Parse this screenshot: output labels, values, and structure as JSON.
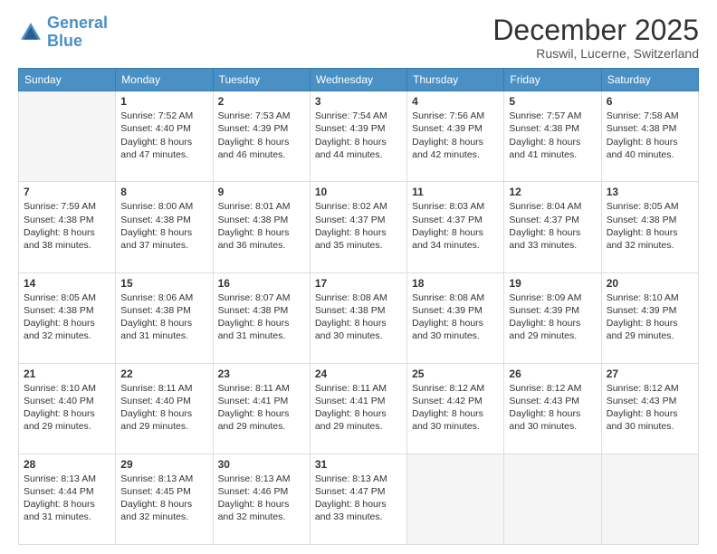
{
  "header": {
    "logo_line1": "General",
    "logo_line2": "Blue",
    "title": "December 2025",
    "subtitle": "Ruswil, Lucerne, Switzerland"
  },
  "columns": [
    "Sunday",
    "Monday",
    "Tuesday",
    "Wednesday",
    "Thursday",
    "Friday",
    "Saturday"
  ],
  "weeks": [
    [
      {
        "day": "",
        "sunrise": "",
        "sunset": "",
        "daylight": ""
      },
      {
        "day": "1",
        "sunrise": "Sunrise: 7:52 AM",
        "sunset": "Sunset: 4:40 PM",
        "daylight": "Daylight: 8 hours and 47 minutes."
      },
      {
        "day": "2",
        "sunrise": "Sunrise: 7:53 AM",
        "sunset": "Sunset: 4:39 PM",
        "daylight": "Daylight: 8 hours and 46 minutes."
      },
      {
        "day": "3",
        "sunrise": "Sunrise: 7:54 AM",
        "sunset": "Sunset: 4:39 PM",
        "daylight": "Daylight: 8 hours and 44 minutes."
      },
      {
        "day": "4",
        "sunrise": "Sunrise: 7:56 AM",
        "sunset": "Sunset: 4:39 PM",
        "daylight": "Daylight: 8 hours and 42 minutes."
      },
      {
        "day": "5",
        "sunrise": "Sunrise: 7:57 AM",
        "sunset": "Sunset: 4:38 PM",
        "daylight": "Daylight: 8 hours and 41 minutes."
      },
      {
        "day": "6",
        "sunrise": "Sunrise: 7:58 AM",
        "sunset": "Sunset: 4:38 PM",
        "daylight": "Daylight: 8 hours and 40 minutes."
      }
    ],
    [
      {
        "day": "7",
        "sunrise": "Sunrise: 7:59 AM",
        "sunset": "Sunset: 4:38 PM",
        "daylight": "Daylight: 8 hours and 38 minutes."
      },
      {
        "day": "8",
        "sunrise": "Sunrise: 8:00 AM",
        "sunset": "Sunset: 4:38 PM",
        "daylight": "Daylight: 8 hours and 37 minutes."
      },
      {
        "day": "9",
        "sunrise": "Sunrise: 8:01 AM",
        "sunset": "Sunset: 4:38 PM",
        "daylight": "Daylight: 8 hours and 36 minutes."
      },
      {
        "day": "10",
        "sunrise": "Sunrise: 8:02 AM",
        "sunset": "Sunset: 4:37 PM",
        "daylight": "Daylight: 8 hours and 35 minutes."
      },
      {
        "day": "11",
        "sunrise": "Sunrise: 8:03 AM",
        "sunset": "Sunset: 4:37 PM",
        "daylight": "Daylight: 8 hours and 34 minutes."
      },
      {
        "day": "12",
        "sunrise": "Sunrise: 8:04 AM",
        "sunset": "Sunset: 4:37 PM",
        "daylight": "Daylight: 8 hours and 33 minutes."
      },
      {
        "day": "13",
        "sunrise": "Sunrise: 8:05 AM",
        "sunset": "Sunset: 4:38 PM",
        "daylight": "Daylight: 8 hours and 32 minutes."
      }
    ],
    [
      {
        "day": "14",
        "sunrise": "Sunrise: 8:05 AM",
        "sunset": "Sunset: 4:38 PM",
        "daylight": "Daylight: 8 hours and 32 minutes."
      },
      {
        "day": "15",
        "sunrise": "Sunrise: 8:06 AM",
        "sunset": "Sunset: 4:38 PM",
        "daylight": "Daylight: 8 hours and 31 minutes."
      },
      {
        "day": "16",
        "sunrise": "Sunrise: 8:07 AM",
        "sunset": "Sunset: 4:38 PM",
        "daylight": "Daylight: 8 hours and 31 minutes."
      },
      {
        "day": "17",
        "sunrise": "Sunrise: 8:08 AM",
        "sunset": "Sunset: 4:38 PM",
        "daylight": "Daylight: 8 hours and 30 minutes."
      },
      {
        "day": "18",
        "sunrise": "Sunrise: 8:08 AM",
        "sunset": "Sunset: 4:39 PM",
        "daylight": "Daylight: 8 hours and 30 minutes."
      },
      {
        "day": "19",
        "sunrise": "Sunrise: 8:09 AM",
        "sunset": "Sunset: 4:39 PM",
        "daylight": "Daylight: 8 hours and 29 minutes."
      },
      {
        "day": "20",
        "sunrise": "Sunrise: 8:10 AM",
        "sunset": "Sunset: 4:39 PM",
        "daylight": "Daylight: 8 hours and 29 minutes."
      }
    ],
    [
      {
        "day": "21",
        "sunrise": "Sunrise: 8:10 AM",
        "sunset": "Sunset: 4:40 PM",
        "daylight": "Daylight: 8 hours and 29 minutes."
      },
      {
        "day": "22",
        "sunrise": "Sunrise: 8:11 AM",
        "sunset": "Sunset: 4:40 PM",
        "daylight": "Daylight: 8 hours and 29 minutes."
      },
      {
        "day": "23",
        "sunrise": "Sunrise: 8:11 AM",
        "sunset": "Sunset: 4:41 PM",
        "daylight": "Daylight: 8 hours and 29 minutes."
      },
      {
        "day": "24",
        "sunrise": "Sunrise: 8:11 AM",
        "sunset": "Sunset: 4:41 PM",
        "daylight": "Daylight: 8 hours and 29 minutes."
      },
      {
        "day": "25",
        "sunrise": "Sunrise: 8:12 AM",
        "sunset": "Sunset: 4:42 PM",
        "daylight": "Daylight: 8 hours and 30 minutes."
      },
      {
        "day": "26",
        "sunrise": "Sunrise: 8:12 AM",
        "sunset": "Sunset: 4:43 PM",
        "daylight": "Daylight: 8 hours and 30 minutes."
      },
      {
        "day": "27",
        "sunrise": "Sunrise: 8:12 AM",
        "sunset": "Sunset: 4:43 PM",
        "daylight": "Daylight: 8 hours and 30 minutes."
      }
    ],
    [
      {
        "day": "28",
        "sunrise": "Sunrise: 8:13 AM",
        "sunset": "Sunset: 4:44 PM",
        "daylight": "Daylight: 8 hours and 31 minutes."
      },
      {
        "day": "29",
        "sunrise": "Sunrise: 8:13 AM",
        "sunset": "Sunset: 4:45 PM",
        "daylight": "Daylight: 8 hours and 32 minutes."
      },
      {
        "day": "30",
        "sunrise": "Sunrise: 8:13 AM",
        "sunset": "Sunset: 4:46 PM",
        "daylight": "Daylight: 8 hours and 32 minutes."
      },
      {
        "day": "31",
        "sunrise": "Sunrise: 8:13 AM",
        "sunset": "Sunset: 4:47 PM",
        "daylight": "Daylight: 8 hours and 33 minutes."
      },
      {
        "day": "",
        "sunrise": "",
        "sunset": "",
        "daylight": ""
      },
      {
        "day": "",
        "sunrise": "",
        "sunset": "",
        "daylight": ""
      },
      {
        "day": "",
        "sunrise": "",
        "sunset": "",
        "daylight": ""
      }
    ]
  ]
}
